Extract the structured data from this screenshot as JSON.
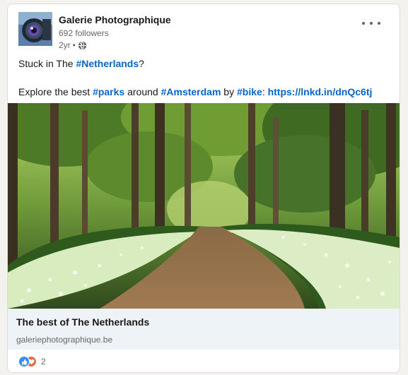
{
  "post": {
    "author_name": "Galerie Photographique",
    "followers": "692 followers",
    "age": "2yr",
    "meta_separator": "•",
    "visibility_icon": "globe-icon",
    "menu_icon": "more-horizontal-icon",
    "text": {
      "line1_prefix": "Stuck in The ",
      "line1_tag": "#Netherlands",
      "line1_suffix": "?",
      "line2_prefix": "Explore the best ",
      "line2_tag1": "#parks",
      "line2_mid1": " around ",
      "line2_tag2": "#Amsterdam",
      "line2_mid2": " by ",
      "line2_tag3": "#bike",
      "line2_mid3": ": ",
      "line2_link": "https://lnkd.in/dnQc6tj"
    },
    "image_description_icon": "forest-path-photo",
    "link_preview": {
      "title": "The best of The Netherlands",
      "domain": "galeriephotographique.be"
    },
    "reactions": {
      "icons": [
        "like-icon",
        "love-icon"
      ],
      "count": "2"
    }
  },
  "colors": {
    "link": "#0a66c2",
    "text": "#191919",
    "muted": "#666666",
    "preview_bg": "#eef3f8"
  }
}
